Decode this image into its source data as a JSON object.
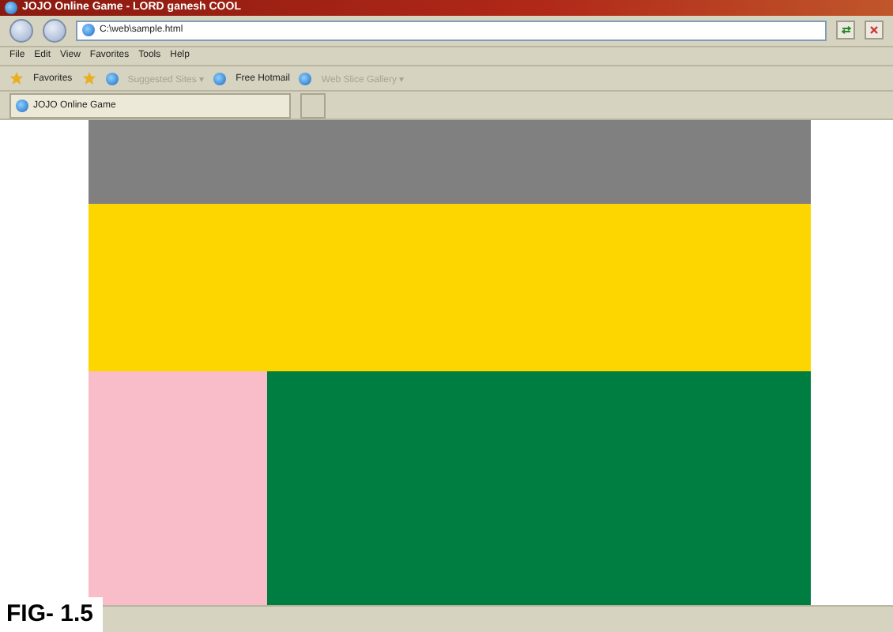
{
  "window": {
    "title": "JOJO Online Game - LORD ganesh COOL"
  },
  "address_bar": {
    "value": "C:\\web\\sample.html"
  },
  "menu": [
    "File",
    "Edit",
    "View",
    "Favorites",
    "Tools",
    "Help"
  ],
  "favorites_bar": {
    "label": "Favorites",
    "items": [
      {
        "label": "Suggested Sites ▾",
        "disabled": true
      },
      {
        "label": "Free Hotmail",
        "disabled": false
      },
      {
        "label": "Web Slice Gallery ▾",
        "disabled": true
      }
    ]
  },
  "tabs": [
    {
      "label": "JOJO Online Game",
      "selected": true
    }
  ],
  "figure_label": "FIG- 1.5"
}
